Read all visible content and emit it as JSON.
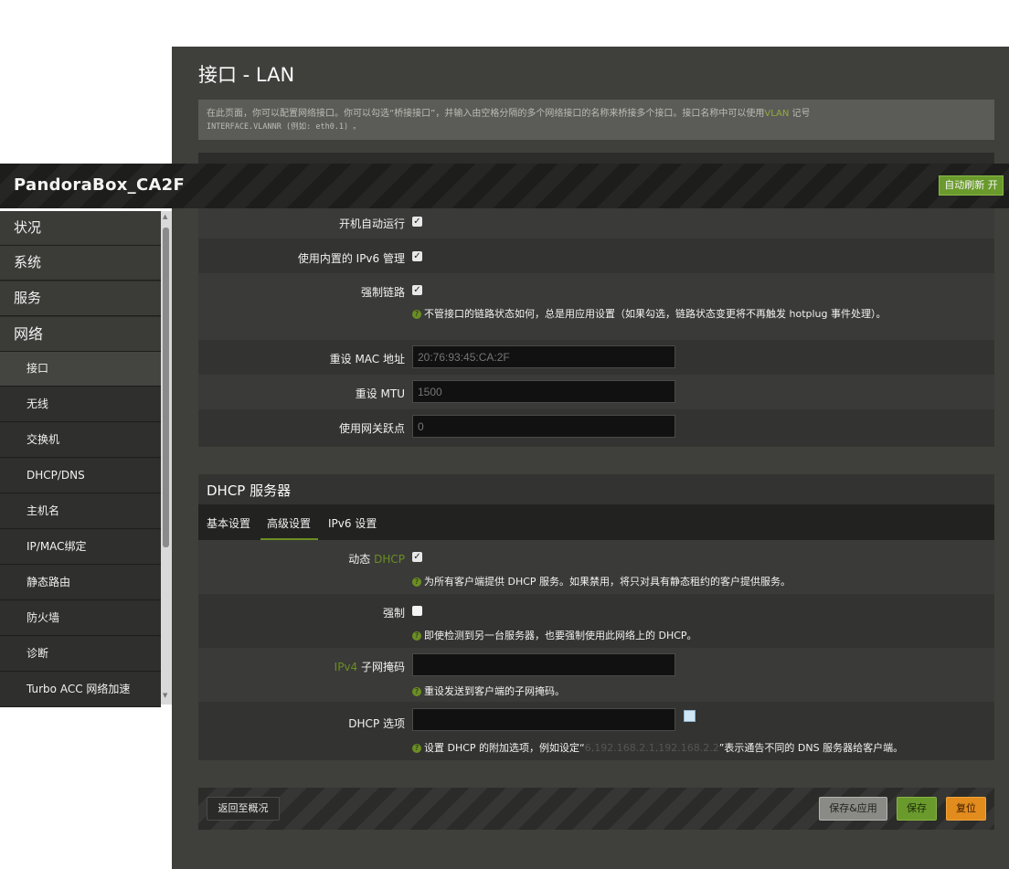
{
  "page": {
    "title": "接口 - LAN",
    "description_line1_a": "在此页面，你可以配置网络接口。你可以勾选“桥接接口”，并输入由空格分隔的多个网络接口的名称来桥接多个接口。接口名称中可以使用",
    "description_vlan": "VLAN",
    "description_line1_b": "记号",
    "description_line2": "INTERFACE.VLANNR (例如: eth0.1) 。"
  },
  "header": {
    "brand": "PandoraBox_CA2F",
    "auto_refresh": "自动刷新 开"
  },
  "sidebar": {
    "items": [
      {
        "label": "状况"
      },
      {
        "label": "系统"
      },
      {
        "label": "服务"
      },
      {
        "label": "网络"
      },
      {
        "label": "接口"
      },
      {
        "label": "无线"
      },
      {
        "label": "交换机"
      },
      {
        "label": "DHCP/DNS"
      },
      {
        "label": "主机名"
      },
      {
        "label": "IP/MAC绑定"
      },
      {
        "label": "静态路由"
      },
      {
        "label": "防火墙"
      },
      {
        "label": "诊断"
      },
      {
        "label": "Turbo ACC 网络加速"
      }
    ]
  },
  "interface_settings": {
    "autostart_label": "开机自动运行",
    "ipv6_label": "使用内置的 IPv6 管理",
    "force_link_label": "强制链路",
    "force_link_hint": "不管接口的链路状态如何，总是用应用设置（如果勾选，链路状态变更将不再触发 hotplug 事件处理）。",
    "mac_label": "重设 MAC 地址",
    "mac_placeholder": "20:76:93:45:CA:2F",
    "mtu_label": "重设 MTU",
    "mtu_placeholder": "1500",
    "metric_label": "使用网关跃点",
    "metric_placeholder": "0"
  },
  "dhcp": {
    "title": "DHCP 服务器",
    "tabs": [
      "基本设置",
      "高级设置",
      "IPv6 设置"
    ],
    "dynamic_label_a": "动态 ",
    "dynamic_label_b": "DHCP",
    "dynamic_hint": "为所有客户端提供 DHCP 服务。如果禁用，将只对具有静态租约的客户提供服务。",
    "force_label": "强制",
    "force_hint": "即使检测到另一台服务器，也要强制使用此网络上的 DHCP。",
    "netmask_label_a": "IPv4 ",
    "netmask_label_b": "子网掩码",
    "netmask_hint": "重设发送到客户端的子网掩码。",
    "options_label": "DHCP 选项",
    "options_hint_a": "设置 DHCP 的附加选项，例如设定“",
    "options_hint_b": "6,192.168.2.1,192.168.2.2",
    "options_hint_c": "”表示通告不同的 DNS 服务器给客户端。"
  },
  "footer": {
    "back": "返回至概况",
    "save_apply": "保存&应用",
    "save": "保存",
    "reset": "复位"
  },
  "states": {
    "autostart_checked": true,
    "ipv6_checked": true,
    "force_link_checked": true,
    "dynamic_dhcp_checked": true,
    "force_dhcp_checked": false
  },
  "colors": {
    "accent_green": "#6a9a2c",
    "reset_orange": "#e28c1e"
  }
}
